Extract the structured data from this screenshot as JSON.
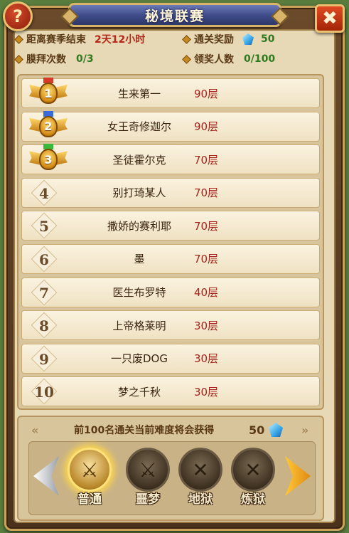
{
  "window": {
    "title": "秘境联赛",
    "help_icon": "?",
    "close_icon": "✖"
  },
  "info": {
    "season_end_label": "距离赛季结束",
    "season_end_value": "2天12小时",
    "clear_reward_label": "通关奖励",
    "clear_reward_value": "50",
    "worship_label": "膜拜次数",
    "worship_value": "0/3",
    "claimers_label": "领奖人数",
    "claimers_value": "0/100"
  },
  "ranking": [
    {
      "rank": "1",
      "name": "生来第一",
      "level": "90层"
    },
    {
      "rank": "2",
      "name": "女王奇修迦尔",
      "level": "90层"
    },
    {
      "rank": "3",
      "name": "圣徒霍尔克",
      "level": "70层"
    },
    {
      "rank": "4",
      "name": "别打琦某人",
      "level": "70层"
    },
    {
      "rank": "5",
      "name": "撒娇的赛利耶",
      "level": "70层"
    },
    {
      "rank": "6",
      "name": "墨",
      "level": "70层"
    },
    {
      "rank": "7",
      "name": "医生布罗特",
      "level": "40层"
    },
    {
      "rank": "8",
      "name": "上帝格莱明",
      "level": "30层"
    },
    {
      "rank": "9",
      "name": "一只废DOG",
      "level": "30层"
    },
    {
      "rank": "10",
      "name": "梦之千秋",
      "level": "30层"
    }
  ],
  "bottom": {
    "reward_text": "前100名通关当前难度将会获得",
    "reward_value": "50"
  },
  "difficulties": [
    {
      "label": "普通",
      "active": true
    },
    {
      "label": "噩梦",
      "active": false
    },
    {
      "label": "地狱",
      "active": false
    },
    {
      "label": "炼狱",
      "active": false
    }
  ],
  "colors": {
    "accent_gold": "#d8b46a",
    "level_red": "#a2241a",
    "value_green": "#2f7a1f",
    "title_blue": "#3d4a87"
  }
}
